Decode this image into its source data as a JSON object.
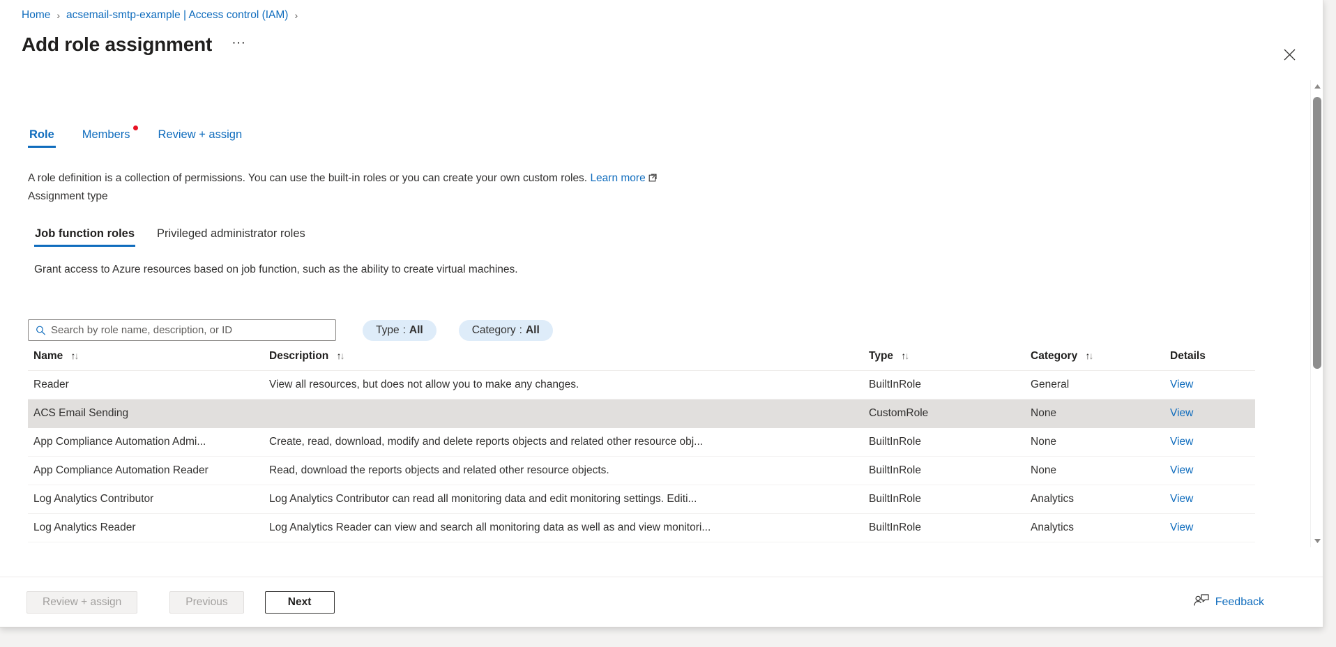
{
  "breadcrumb": {
    "items": [
      {
        "label": "Home",
        "link": true
      },
      {
        "label": "acsemail-smtp-example | Access control (IAM)",
        "link": true
      }
    ],
    "separator": "›"
  },
  "header": {
    "title": "Add role assignment",
    "more_label": "···",
    "close_icon": "close-icon"
  },
  "tabs": [
    {
      "label": "Role",
      "active": true,
      "badge": false
    },
    {
      "label": "Members",
      "active": false,
      "badge": true
    },
    {
      "label": "Review + assign",
      "active": false,
      "badge": false
    }
  ],
  "intro": {
    "text": "A role definition is a collection of permissions. You can use the built-in roles or you can create your own custom roles.",
    "link_label": "Learn more",
    "assignment_type_label": "Assignment type"
  },
  "subtabs": [
    {
      "label": "Job function roles",
      "active": true
    },
    {
      "label": "Privileged administrator roles",
      "active": false
    }
  ],
  "grant_text": "Grant access to Azure resources based on job function, such as the ability to create virtual machines.",
  "search": {
    "placeholder": "Search by role name, description, or ID",
    "value": "",
    "icon": "search-icon"
  },
  "filters": [
    {
      "key": "Type",
      "separator": ":",
      "value": "All"
    },
    {
      "key": "Category",
      "separator": ":",
      "value": "All"
    }
  ],
  "table": {
    "columns": [
      {
        "label": "Name",
        "sortable": true
      },
      {
        "label": "Description",
        "sortable": true
      },
      {
        "label": "Type",
        "sortable": true
      },
      {
        "label": "Category",
        "sortable": true
      },
      {
        "label": "Details",
        "sortable": false
      }
    ],
    "sort_up": "↑",
    "sort_down": "↓",
    "details_link_label": "View",
    "rows": [
      {
        "name": "Reader",
        "description": "View all resources, but does not allow you to make any changes.",
        "type": "BuiltInRole",
        "category": "General",
        "details": "View",
        "selected": false
      },
      {
        "name": "ACS Email Sending",
        "description": "",
        "type": "CustomRole",
        "category": "None",
        "details": "View",
        "selected": true
      },
      {
        "name": "App Compliance Automation Admi...",
        "description": "Create, read, download, modify and delete reports objects and related other resource obj...",
        "type": "BuiltInRole",
        "category": "None",
        "details": "View",
        "selected": false
      },
      {
        "name": "App Compliance Automation Reader",
        "description": "Read, download the reports objects and related other resource objects.",
        "type": "BuiltInRole",
        "category": "None",
        "details": "View",
        "selected": false
      },
      {
        "name": "Log Analytics Contributor",
        "description": "Log Analytics Contributor can read all monitoring data and edit monitoring settings. Editi...",
        "type": "BuiltInRole",
        "category": "Analytics",
        "details": "View",
        "selected": false
      },
      {
        "name": "Log Analytics Reader",
        "description": "Log Analytics Reader can view and search all monitoring data as well as and view monitori...",
        "type": "BuiltInRole",
        "category": "Analytics",
        "details": "View",
        "selected": false
      }
    ]
  },
  "footer": {
    "review_label": "Review + assign",
    "review_disabled": true,
    "previous_label": "Previous",
    "previous_disabled": true,
    "next_label": "Next",
    "next_disabled": false,
    "feedback_label": "Feedback",
    "feedback_icon": "feedback-person-icon"
  },
  "colors": {
    "accent": "#0f6cbd",
    "badge": "#e81123",
    "pill_bg": "#deecf9",
    "selected_row": "#e1dfdd"
  }
}
